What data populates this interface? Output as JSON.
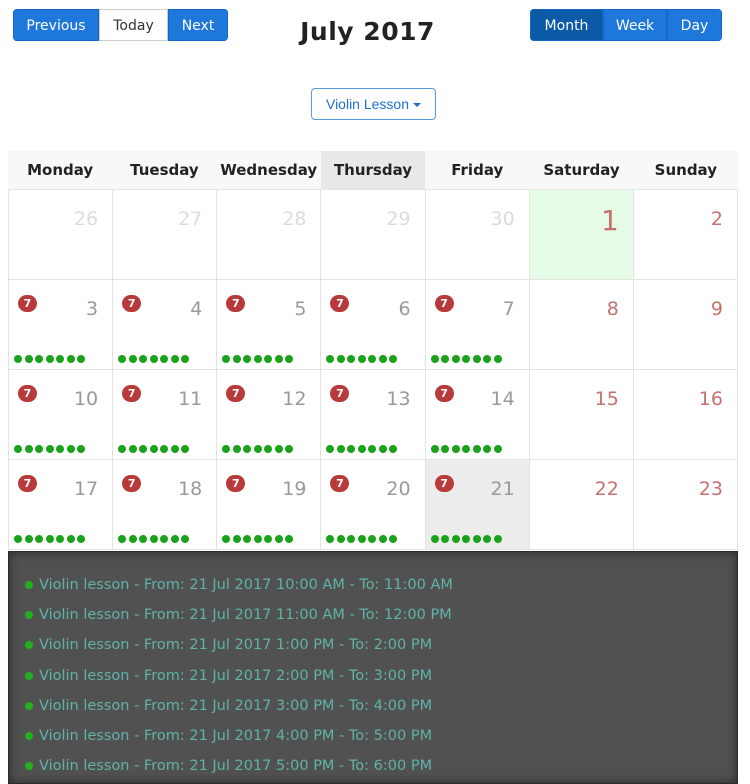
{
  "toolbar": {
    "previous_label": "Previous",
    "today_label": "Today",
    "next_label": "Next",
    "title": "July 2017",
    "views": [
      "Month",
      "Week",
      "Day"
    ],
    "active_view": "Month"
  },
  "filter": {
    "selected": "Violin Lesson"
  },
  "colors": {
    "primary": "#1e78dc",
    "active_view": "#0b5aa8",
    "badge": "#b83a3a",
    "event_dot": "#1aa31a",
    "highlight_day": "#e5fbe5",
    "event_text": "#5fb3a8"
  },
  "calendar": {
    "weekdays": [
      "Monday",
      "Tuesday",
      "Wednesday",
      "Thursday",
      "Friday",
      "Saturday",
      "Sunday"
    ],
    "weeks": [
      [
        {
          "day": "26",
          "type": "other"
        },
        {
          "day": "27",
          "type": "other"
        },
        {
          "day": "28",
          "type": "other"
        },
        {
          "day": "29",
          "type": "other"
        },
        {
          "day": "30",
          "type": "other"
        },
        {
          "day": "1",
          "type": "highlight"
        },
        {
          "day": "2",
          "type": "weekend"
        }
      ],
      [
        {
          "day": "3",
          "badge": "7",
          "dots": 7
        },
        {
          "day": "4",
          "badge": "7",
          "dots": 7
        },
        {
          "day": "5",
          "badge": "7",
          "dots": 7
        },
        {
          "day": "6",
          "badge": "7",
          "dots": 7
        },
        {
          "day": "7",
          "badge": "7",
          "dots": 7
        },
        {
          "day": "8",
          "type": "weekend"
        },
        {
          "day": "9",
          "type": "weekend"
        }
      ],
      [
        {
          "day": "10",
          "badge": "7",
          "dots": 7
        },
        {
          "day": "11",
          "badge": "7",
          "dots": 7
        },
        {
          "day": "12",
          "badge": "7",
          "dots": 7
        },
        {
          "day": "13",
          "badge": "7",
          "dots": 7
        },
        {
          "day": "14",
          "badge": "7",
          "dots": 7
        },
        {
          "day": "15",
          "type": "weekend"
        },
        {
          "day": "16",
          "type": "weekend"
        }
      ],
      [
        {
          "day": "17",
          "badge": "7",
          "dots": 7
        },
        {
          "day": "18",
          "badge": "7",
          "dots": 7
        },
        {
          "day": "19",
          "badge": "7",
          "dots": 7
        },
        {
          "day": "20",
          "badge": "7",
          "dots": 7
        },
        {
          "day": "21",
          "badge": "7",
          "dots": 7,
          "type": "selected"
        },
        {
          "day": "22",
          "type": "weekend"
        },
        {
          "day": "23",
          "type": "weekend"
        }
      ]
    ]
  },
  "events": [
    "Violin lesson - From: 21 Jul 2017 10:00 AM - To: 11:00 AM",
    "Violin lesson - From: 21 Jul 2017 11:00 AM - To: 12:00 PM",
    "Violin lesson - From: 21 Jul 2017 1:00 PM - To: 2:00 PM",
    "Violin lesson - From: 21 Jul 2017 2:00 PM - To: 3:00 PM",
    "Violin lesson - From: 21 Jul 2017 3:00 PM - To: 4:00 PM",
    "Violin lesson - From: 21 Jul 2017 4:00 PM - To: 5:00 PM",
    "Violin lesson - From: 21 Jul 2017 5:00 PM - To: 6:00 PM"
  ]
}
